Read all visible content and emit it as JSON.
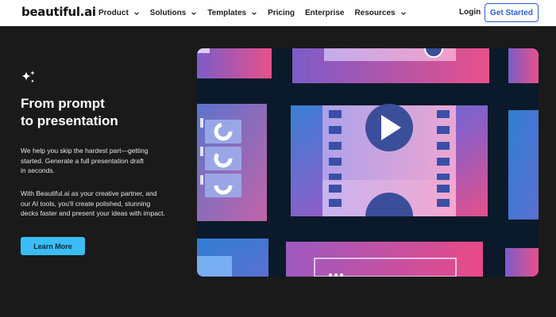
{
  "nav": {
    "logo": "beautiful.ai",
    "items": [
      {
        "label": "Product",
        "has_dropdown": true
      },
      {
        "label": "Solutions",
        "has_dropdown": true
      },
      {
        "label": "Templates",
        "has_dropdown": true
      },
      {
        "label": "Pricing",
        "has_dropdown": false
      },
      {
        "label": "Enterprise",
        "has_dropdown": false
      },
      {
        "label": "Resources",
        "has_dropdown": true
      }
    ],
    "login": "Login",
    "cta": "Get Started"
  },
  "hero": {
    "headline_line1": "From prompt",
    "headline_line2": "to presentation",
    "para1_line1": "We help you skip the hardest part—getting",
    "para1_line2": "started. Generate a full presentation draft",
    "para1_line3": "in seconds.",
    "para2_line1": "With Beautiful.ai as your creative partner, and",
    "para2_line2": "our AI tools, you'll create polished, stunning",
    "para2_line3": "decks faster and present your ideas with impact.",
    "button": "Learn More"
  },
  "colors": {
    "page_bg": "#1a1a1a",
    "nav_bg": "#ffffff",
    "cta_border": "#2b5cd6",
    "learn_button": "#3bbcf5"
  }
}
